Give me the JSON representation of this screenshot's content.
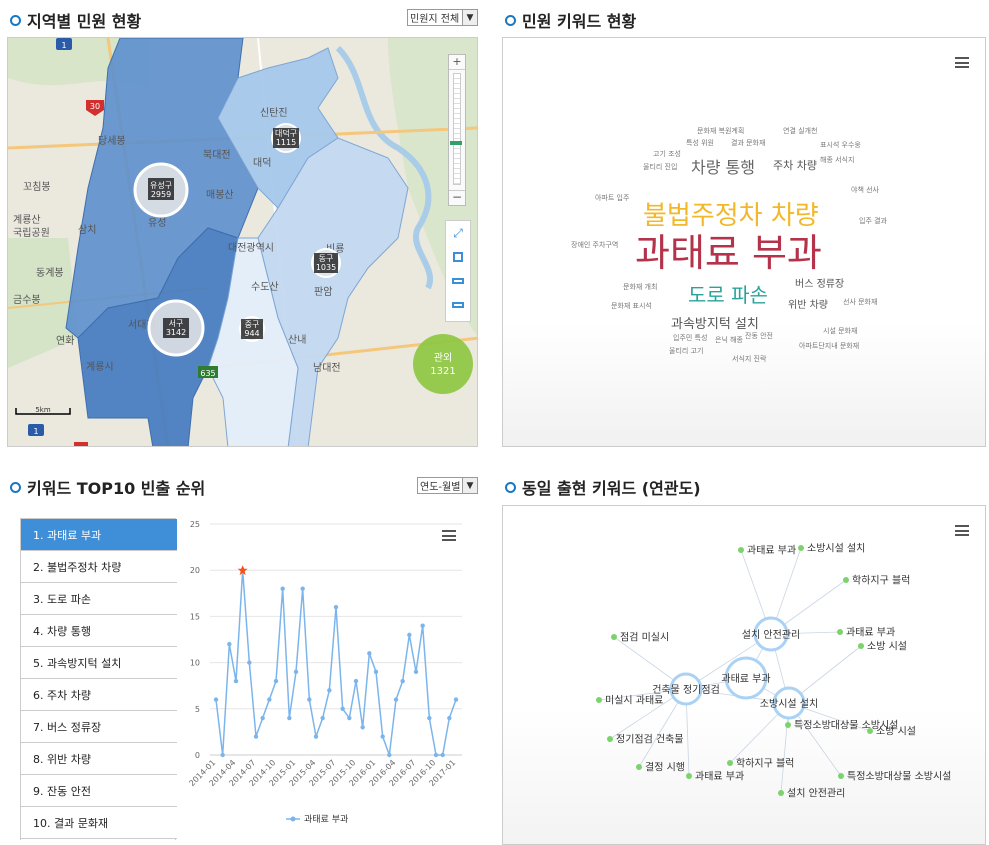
{
  "sections": {
    "map_title": "지역별 민원 현황",
    "keyword_title": "민원 키워드 현황",
    "top10_title": "키워드 TOP10 빈출 순위",
    "related_title": "동일 출현 키워드 (연관도)"
  },
  "selects": {
    "map_filter": "민원지 전체",
    "top10_period": "연도-월별"
  },
  "map": {
    "districts": [
      {
        "name": "유성구",
        "count": "2959"
      },
      {
        "name": "대덕구",
        "count": "1115"
      },
      {
        "name": "동구",
        "count": "1035"
      },
      {
        "name": "서구",
        "count": "3142"
      },
      {
        "name": "중구",
        "count": "944"
      }
    ],
    "outside": {
      "name": "관외",
      "count": "1321"
    },
    "place_labels": [
      "대전광역시",
      "계룡시",
      "유성",
      "북대전",
      "매봉산",
      "신탄진",
      "대덕",
      "비룡",
      "판암",
      "수도산",
      "산내",
      "남대전",
      "서대전",
      "연화",
      "삼치",
      "계룡산",
      "국립공원",
      "동계봉",
      "꼬침봉",
      "금수봉",
      "당세봉"
    ],
    "road_numbers": [
      "1",
      "30",
      "635",
      "1"
    ],
    "scale": "5km",
    "controls": [
      "zoom-in",
      "zoom-out",
      "fullscreen",
      "save",
      "layer1",
      "layer2"
    ]
  },
  "wordcloud": {
    "words": [
      {
        "text": "과태료 부과",
        "size": 38,
        "color": "#b5334a"
      },
      {
        "text": "불법주정차 차량",
        "size": 26,
        "color": "#f2b82a"
      },
      {
        "text": "도로 파손",
        "size": 20,
        "color": "#2aa39a"
      },
      {
        "text": "차량 통행",
        "size": 16,
        "color": "#666"
      },
      {
        "text": "과속방지턱 설치",
        "size": 13,
        "color": "#555"
      },
      {
        "text": "주차 차량",
        "size": 11,
        "color": "#555"
      },
      {
        "text": "버스 정류장",
        "size": 10,
        "color": "#555"
      },
      {
        "text": "위반 차량",
        "size": 10,
        "color": "#555"
      },
      {
        "text": "문화재 복원계획",
        "size": 7,
        "color": "#777"
      },
      {
        "text": "연결 실개천",
        "size": 7,
        "color": "#777"
      },
      {
        "text": "특성 위원",
        "size": 7,
        "color": "#777"
      },
      {
        "text": "결과 문화재",
        "size": 7,
        "color": "#777"
      },
      {
        "text": "표시석 우수웅",
        "size": 7,
        "color": "#777"
      },
      {
        "text": "고기 조성",
        "size": 7,
        "color": "#777"
      },
      {
        "text": "해종 서식지",
        "size": 7,
        "color": "#777"
      },
      {
        "text": "울티리 진입",
        "size": 7,
        "color": "#777"
      },
      {
        "text": "아파트 입주",
        "size": 7,
        "color": "#777"
      },
      {
        "text": "야책 선사",
        "size": 7,
        "color": "#777"
      },
      {
        "text": "입주 결과",
        "size": 7,
        "color": "#777"
      },
      {
        "text": "장애인 주차구역",
        "size": 7,
        "color": "#777"
      },
      {
        "text": "문화재 개최",
        "size": 7,
        "color": "#777"
      },
      {
        "text": "문화재 표시석",
        "size": 7,
        "color": "#777"
      },
      {
        "text": "선사 문화재",
        "size": 7,
        "color": "#777"
      },
      {
        "text": "시설 문화재",
        "size": 7,
        "color": "#777"
      },
      {
        "text": "입주민 특성",
        "size": 7,
        "color": "#777"
      },
      {
        "text": "잔동 안전",
        "size": 7,
        "color": "#777"
      },
      {
        "text": "은닉 해종",
        "size": 7,
        "color": "#777"
      },
      {
        "text": "울티리 고기",
        "size": 7,
        "color": "#777"
      },
      {
        "text": "아파트단지내 문화재",
        "size": 7,
        "color": "#777"
      },
      {
        "text": "서식지 진락",
        "size": 7,
        "color": "#777"
      }
    ]
  },
  "top10": {
    "items": [
      "1. 과태료 부과",
      "2. 불법주정차 차량",
      "3. 도로 파손",
      "4. 차량 통행",
      "5. 과속방지턱 설치",
      "6. 주차 차량",
      "7. 버스 정류장",
      "8. 위반 차량",
      "9. 잔동 안전",
      "10. 결과 문화재"
    ],
    "active_index": 0
  },
  "chart_data": {
    "type": "line",
    "title": "",
    "xlabel": "",
    "ylabel": "",
    "ylim": [
      0,
      25
    ],
    "yticks": [
      0,
      5,
      10,
      15,
      20,
      25
    ],
    "x": [
      "2014-01",
      "2014-02",
      "2014-03",
      "2014-04",
      "2014-05",
      "2014-06",
      "2014-07",
      "2014-08",
      "2014-09",
      "2014-10",
      "2014-11",
      "2014-12",
      "2015-01",
      "2015-02",
      "2015-03",
      "2015-04",
      "2015-05",
      "2015-06",
      "2015-07",
      "2015-08",
      "2015-09",
      "2015-10",
      "2015-11",
      "2015-12",
      "2016-01",
      "2016-02",
      "2016-03",
      "2016-04",
      "2016-05",
      "2016-06",
      "2016-07",
      "2016-08",
      "2016-09",
      "2016-10",
      "2016-11",
      "2016-12",
      "2017-01",
      "2017-02"
    ],
    "xtick_labels": [
      "2014-01",
      "2014-04",
      "2014-07",
      "2014-10",
      "2015-01",
      "2015-04",
      "2015-07",
      "2015-10",
      "2016-01",
      "2016-04",
      "2016-07",
      "2016-10",
      "2017-01"
    ],
    "series": [
      {
        "name": "과태료 부과",
        "color": "#7cb5ec",
        "values": [
          6,
          0,
          12,
          8,
          20,
          10,
          2,
          4,
          6,
          8,
          18,
          4,
          9,
          18,
          6,
          2,
          4,
          7,
          16,
          5,
          4,
          8,
          3,
          11,
          9,
          2,
          0,
          6,
          8,
          13,
          9,
          14,
          4,
          0,
          0,
          4,
          6
        ]
      }
    ],
    "highlight_index": 4,
    "legend": "bottom"
  },
  "network": {
    "hubs": [
      {
        "label": "설치 안전관리"
      },
      {
        "label": "과태료 부과"
      },
      {
        "label": "건축물 정기점검"
      },
      {
        "label": "소방시설 설치"
      }
    ],
    "leaves": [
      "과태료 부과",
      "소방시설 설치",
      "학하지구 블럭",
      "과태료 부과",
      "소방 시설",
      "점검 미실시",
      "미실시 과태료",
      "특정소방대상물 소방시설",
      "소방 시설",
      "정기점검 건축물",
      "결정 시행",
      "학하지구 블럭",
      "과태료 부과",
      "특정소방대상물 소방시설",
      "설치 안전관리"
    ]
  },
  "colors": {
    "accent": "#1a78c2",
    "active_rank": "#3f8fd8",
    "leaf_node": "#7bd36b",
    "hub_ring": "#a9d2f5",
    "outside_bubble": "#8cc63f"
  }
}
